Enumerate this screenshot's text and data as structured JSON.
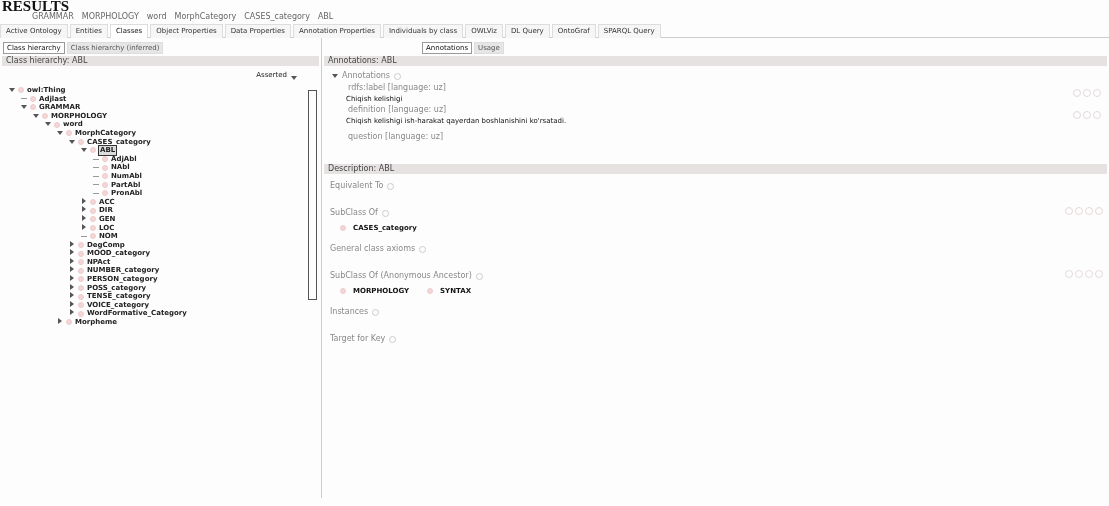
{
  "heading": "RESULTS",
  "breadcrumb": [
    "GRAMMAR",
    "MORPHOLOGY",
    "word",
    "MorphCategory",
    "CASES_category",
    "ABL"
  ],
  "tabs": [
    {
      "label": "Active Ontology",
      "selected": false
    },
    {
      "label": "Entities",
      "selected": false
    },
    {
      "label": "Classes",
      "selected": true
    },
    {
      "label": "Object Properties",
      "selected": false
    },
    {
      "label": "Data Properties",
      "selected": false
    },
    {
      "label": "Annotation Properties",
      "selected": false
    },
    {
      "label": "Individuals by class",
      "selected": false
    },
    {
      "label": "OWLViz",
      "selected": false
    },
    {
      "label": "DL Query",
      "selected": false
    },
    {
      "label": "OntoGraf",
      "selected": false
    },
    {
      "label": "SPARQL Query",
      "selected": false
    }
  ],
  "left_tabs": [
    {
      "label": "Class hierarchy",
      "selected": true
    },
    {
      "label": "Class hierarchy (inferred)",
      "selected": false
    }
  ],
  "left_header": "Class hierarchy: ABL",
  "view_mode": "Asserted",
  "tree": [
    {
      "label": "owl:Thing",
      "kind": "branch",
      "expanded": true,
      "selected": false,
      "children": [
        {
          "label": "Adjlast",
          "kind": "leaf",
          "selected": false
        },
        {
          "label": "GRAMMAR",
          "kind": "branch",
          "expanded": true,
          "selected": false,
          "children": [
            {
              "label": "MORPHOLOGY",
              "kind": "branch",
              "expanded": true,
              "selected": false,
              "children": [
                {
                  "label": "word",
                  "kind": "branch",
                  "expanded": true,
                  "selected": false,
                  "children": [
                    {
                      "label": "MorphCategory",
                      "kind": "branch",
                      "expanded": true,
                      "selected": false,
                      "children": [
                        {
                          "label": "CASES_category",
                          "kind": "branch",
                          "expanded": true,
                          "selected": false,
                          "children": [
                            {
                              "label": "ABL",
                              "kind": "branch",
                              "expanded": true,
                              "selected": true,
                              "children": [
                                {
                                  "label": "AdjAbl",
                                  "kind": "leaf",
                                  "selected": false
                                },
                                {
                                  "label": "NAbl",
                                  "kind": "leaf",
                                  "selected": false
                                },
                                {
                                  "label": "NumAbl",
                                  "kind": "leaf",
                                  "selected": false
                                },
                                {
                                  "label": "PartAbl",
                                  "kind": "leaf",
                                  "selected": false
                                },
                                {
                                  "label": "PronAbl",
                                  "kind": "leaf",
                                  "selected": false
                                }
                              ]
                            },
                            {
                              "label": "ACC",
                              "kind": "branch",
                              "expanded": false,
                              "selected": false
                            },
                            {
                              "label": "DIR",
                              "kind": "branch",
                              "expanded": false,
                              "selected": false
                            },
                            {
                              "label": "GEN",
                              "kind": "branch",
                              "expanded": false,
                              "selected": false
                            },
                            {
                              "label": "LOC",
                              "kind": "branch",
                              "expanded": false,
                              "selected": false
                            },
                            {
                              "label": "NOM",
                              "kind": "leaf",
                              "selected": false
                            }
                          ]
                        },
                        {
                          "label": "DegComp",
                          "kind": "branch",
                          "expanded": false,
                          "selected": false
                        },
                        {
                          "label": "MOOD_category",
                          "kind": "branch",
                          "expanded": false,
                          "selected": false
                        },
                        {
                          "label": "NPAct",
                          "kind": "branch",
                          "expanded": false,
                          "selected": false
                        },
                        {
                          "label": "NUMBER_category",
                          "kind": "branch",
                          "expanded": false,
                          "selected": false
                        },
                        {
                          "label": "PERSON_category",
                          "kind": "branch",
                          "expanded": false,
                          "selected": false
                        },
                        {
                          "label": "POSS_category",
                          "kind": "branch",
                          "expanded": false,
                          "selected": false
                        },
                        {
                          "label": "TENSE_category",
                          "kind": "branch",
                          "expanded": false,
                          "selected": false
                        },
                        {
                          "label": "VOICE_category",
                          "kind": "branch",
                          "expanded": false,
                          "selected": false
                        },
                        {
                          "label": "WordFormative_Category",
                          "kind": "branch",
                          "expanded": false,
                          "selected": false
                        }
                      ]
                    },
                    {
                      "label": "Morpheme",
                      "kind": "branch",
                      "expanded": false,
                      "selected": false
                    }
                  ]
                }
              ]
            }
          ]
        }
      ]
    }
  ],
  "right_tabs": [
    {
      "label": "Annotations",
      "selected": true
    },
    {
      "label": "Usage",
      "selected": false
    }
  ],
  "annotations": {
    "header": "Annotations: ABL",
    "title": "Annotations",
    "items": [
      {
        "property": "rdfs:label [language: uz]",
        "value": "Chiqish kelishigi"
      },
      {
        "property": "definition [language: uz]",
        "value": "Chiqish kelishigi ish-harakat qayerdan boshlanishini ko'rsatadi."
      },
      {
        "property": "question [language: uz]"
      }
    ]
  },
  "description": {
    "header": "Description: ABL",
    "sections": [
      {
        "title": "Equivalent To"
      },
      {
        "title": "SubClass Of",
        "items": [
          "CASES_category"
        ]
      },
      {
        "title": "General class axioms"
      },
      {
        "title": "SubClass Of (Anonymous Ancestor)",
        "items": [
          "MORPHOLOGY",
          "SYNTAX"
        ]
      },
      {
        "title": "Instances"
      },
      {
        "title": "Target for Key"
      }
    ]
  }
}
